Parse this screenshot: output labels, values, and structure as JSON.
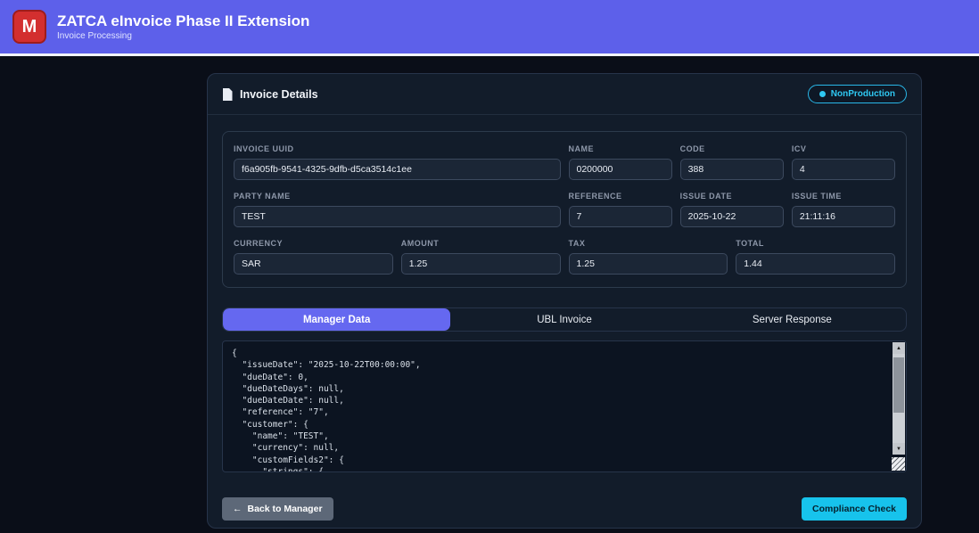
{
  "header": {
    "title": "ZATCA eInvoice Phase II Extension",
    "subtitle": "Invoice Processing",
    "logo_letter": "M"
  },
  "card": {
    "title": "Invoice Details",
    "badge": {
      "label": "NonProduction",
      "dot_icon": "●"
    },
    "fields": {
      "invoice_uuid": {
        "label": "INVOICE UUID",
        "value": "f6a905fb-9541-4325-9dfb-d5ca3514c1ee"
      },
      "name": {
        "label": "NAME",
        "value": "0200000"
      },
      "code": {
        "label": "CODE",
        "value": "388"
      },
      "icv": {
        "label": "ICV",
        "value": "4"
      },
      "party_name": {
        "label": "PARTY NAME",
        "value": "TEST"
      },
      "reference": {
        "label": "REFERENCE",
        "value": "7"
      },
      "issue_date": {
        "label": "ISSUE DATE",
        "value": "2025-10-22"
      },
      "issue_time": {
        "label": "ISSUE TIME",
        "value": "21:11:16"
      },
      "currency": {
        "label": "CURRENCY",
        "value": "SAR"
      },
      "amount": {
        "label": "AMOUNT",
        "value": "1.25"
      },
      "tax": {
        "label": "TAX",
        "value": "1.25"
      },
      "total": {
        "label": "TOTAL",
        "value": "1.44"
      }
    },
    "tabs": [
      {
        "label": "Manager Data"
      },
      {
        "label": "UBL Invoice"
      },
      {
        "label": "Server Response"
      }
    ],
    "active_tab": "Manager Data",
    "editor": {
      "content": "{\n  \"issueDate\": \"2025-10-22T00:00:00\",\n  \"dueDate\": 0,\n  \"dueDateDays\": null,\n  \"dueDateDate\": null,\n  \"reference\": \"7\",\n  \"customer\": {\n    \"name\": \"TEST\",\n    \"currency\": null,\n    \"customFields2\": {\n      \"strings\": {",
      "scroll_up_icon": "▲",
      "scroll_down_icon": "▼"
    },
    "actions": {
      "back_arrow_icon": "←",
      "back_label": "Back to Manager",
      "compliance_label": "Compliance Check"
    }
  },
  "colors": {
    "header_purple": "#5d60ea",
    "accent_indigo": "#6568f0",
    "accent_cyan": "#17c3ec",
    "badge_cyan": "#2fc8f2",
    "logo_red": "#d32f2f",
    "page_background": "#0a0e18",
    "card_background": "#121c2a"
  }
}
